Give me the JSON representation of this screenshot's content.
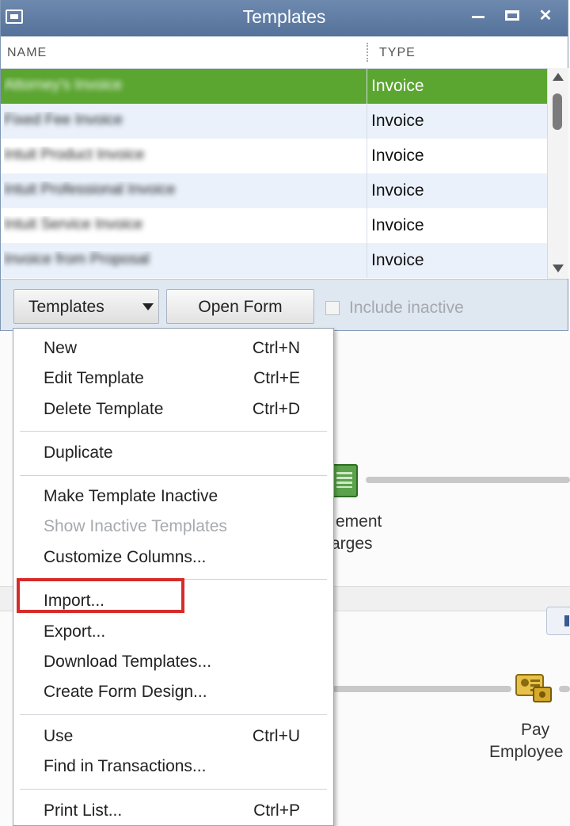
{
  "window": {
    "title": "Templates"
  },
  "list": {
    "columns": {
      "name": "NAME",
      "type": "TYPE"
    },
    "rows": [
      {
        "name": "Attorney's Invoice",
        "type": "Invoice",
        "selected": true
      },
      {
        "name": "Fixed Fee Invoice",
        "type": "Invoice"
      },
      {
        "name": "Intuit Product Invoice",
        "type": "Invoice"
      },
      {
        "name": "Intuit Professional Invoice",
        "type": "Invoice"
      },
      {
        "name": "Intuit Service Invoice",
        "type": "Invoice"
      },
      {
        "name": "Invoice from Proposal",
        "type": "Invoice"
      }
    ]
  },
  "toolbar": {
    "templates_label": "Templates",
    "open_form_label": "Open Form",
    "include_inactive_label": "Include inactive",
    "include_inactive_checked": false
  },
  "menu": {
    "items": [
      {
        "label": "New",
        "shortcut": "Ctrl+N",
        "enabled": true
      },
      {
        "label": "Edit Template",
        "shortcut": "Ctrl+E",
        "enabled": true
      },
      {
        "label": "Delete Template",
        "shortcut": "Ctrl+D",
        "enabled": true
      },
      {
        "label": "Duplicate",
        "shortcut": "",
        "enabled": true
      },
      {
        "label": "Make Template Inactive",
        "shortcut": "",
        "enabled": true
      },
      {
        "label": "Show Inactive Templates",
        "shortcut": "",
        "enabled": false
      },
      {
        "label": "Customize Columns...",
        "shortcut": "",
        "enabled": true
      },
      {
        "label": "Import...",
        "shortcut": "",
        "enabled": true,
        "highlighted": true
      },
      {
        "label": "Export...",
        "shortcut": "",
        "enabled": true
      },
      {
        "label": "Download Templates...",
        "shortcut": "",
        "enabled": true
      },
      {
        "label": "Create Form Design...",
        "shortcut": "",
        "enabled": true
      },
      {
        "label": "Use",
        "shortcut": "Ctrl+U",
        "enabled": true
      },
      {
        "label": "Find in Transactions...",
        "shortcut": "",
        "enabled": true
      },
      {
        "label": "Print List...",
        "shortcut": "Ctrl+P",
        "enabled": true
      }
    ]
  },
  "background": {
    "partial_label_1": "ement",
    "partial_label_2": "arges",
    "pay_label_1": "Pay",
    "pay_label_2": "Employee"
  },
  "colors": {
    "selection": "#5ba531",
    "highlight_box": "#d62b2b",
    "titlebar": "#6e89ae"
  }
}
